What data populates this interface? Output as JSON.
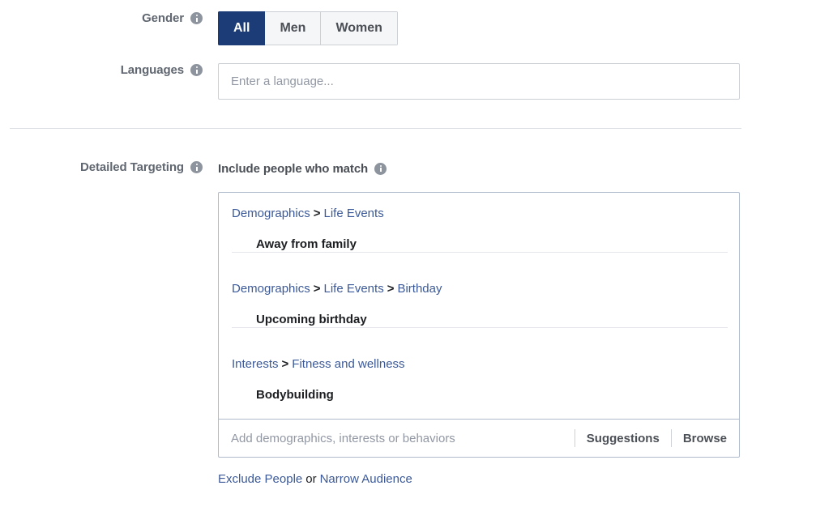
{
  "colors": {
    "link": "#3b5998",
    "selected_button_bg": "#1c3c78",
    "label_gray": "#606770",
    "placeholder": "#9197a3",
    "box_border": "#b0bacd",
    "divider": "#dadde1"
  },
  "gender": {
    "label": "Gender",
    "info_icon": "info-icon",
    "options": [
      {
        "label": "All",
        "selected": true
      },
      {
        "label": "Men",
        "selected": false
      },
      {
        "label": "Women",
        "selected": false
      }
    ]
  },
  "languages": {
    "label": "Languages",
    "info_icon": "info-icon",
    "placeholder": "Enter a language...",
    "value": ""
  },
  "detailed_targeting": {
    "label": "Detailed Targeting",
    "info_icon": "info-icon",
    "subhead": "Include people who match",
    "subhead_info_icon": "info-icon",
    "items": [
      {
        "crumbs": [
          "Demographics",
          "Life Events"
        ],
        "separator": ">",
        "name": "Away from family"
      },
      {
        "crumbs": [
          "Demographics",
          "Life Events",
          "Birthday"
        ],
        "separator": ">",
        "name": "Upcoming birthday"
      },
      {
        "crumbs": [
          "Interests",
          "Fitness and wellness"
        ],
        "separator": ">",
        "name": "Bodybuilding"
      }
    ],
    "search": {
      "placeholder": "Add demographics, interests or behaviors",
      "value": "",
      "suggestions_label": "Suggestions",
      "browse_label": "Browse"
    },
    "footer": {
      "exclude_label": "Exclude People",
      "or_label": "or",
      "narrow_label": "Narrow Audience"
    }
  }
}
